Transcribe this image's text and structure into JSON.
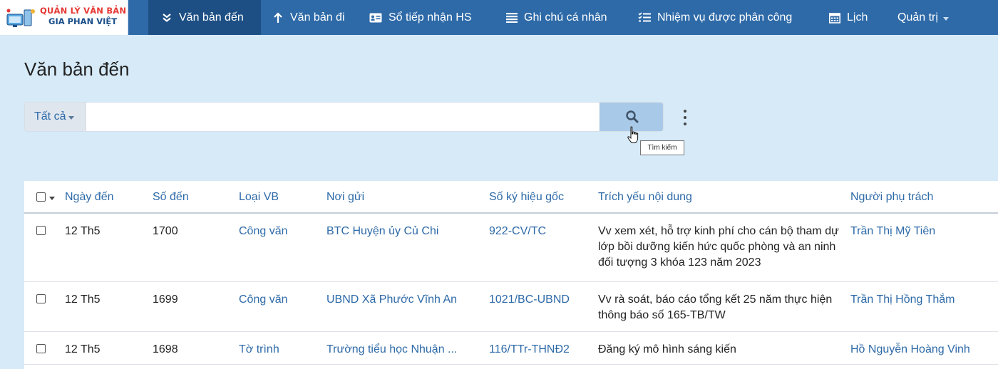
{
  "logo": {
    "line1": "QUẢN LÝ VĂN BẢN",
    "line2": "GIA PHAN VIỆT"
  },
  "nav": {
    "items": [
      {
        "label": "Văn bản đến",
        "icon": "double-chevron-down-icon",
        "active": true
      },
      {
        "label": "Văn bản đi",
        "icon": "arrow-up-icon",
        "active": false
      },
      {
        "label": "Sổ tiếp nhận HS",
        "icon": "id-card-icon",
        "active": false
      },
      {
        "label": "Ghi chú cá nhân",
        "icon": "list-lines-icon",
        "active": false
      },
      {
        "label": "Nhiệm vụ được phân công",
        "icon": "checklist-icon",
        "active": false
      },
      {
        "label": "Lịch",
        "icon": "calendar-icon",
        "active": false
      },
      {
        "label": "Quản trị",
        "icon": "caret-down-icon",
        "active": false
      }
    ]
  },
  "page": {
    "title": "Văn bản đến"
  },
  "search": {
    "scope_label": "Tất cả",
    "value": "",
    "placeholder": "",
    "button_icon": "search-icon",
    "tooltip": "Tìm kiếm"
  },
  "table": {
    "headers": {
      "date": "Ngày đến",
      "number": "Số đến",
      "type": "Loại VB",
      "sender": "Nơi gửi",
      "code": "Số ký hiệu gốc",
      "summary": "Trích yếu nội dung",
      "owner": "Người phụ trách"
    },
    "rows": [
      {
        "date": "12 Th5",
        "number": "1700",
        "type": "Công văn",
        "sender": "BTC Huyện ủy Củ Chi",
        "code": "922-CV/TC",
        "summary": "Vv xem xét, hỗ trợ kinh phí cho cán bộ tham dự lớp bồi dưỡng kiến hức quốc phòng và an ninh đối tượng 3 khóa 123 năm 2023",
        "owner": "Trần Thị Mỹ Tiên"
      },
      {
        "date": "12 Th5",
        "number": "1699",
        "type": "Công văn",
        "sender": "UBND Xã Phước Vĩnh An",
        "code": "1021/BC-UBND",
        "summary": "Vv rà soát, báo cáo tổng kết 25 năm thực hiện thông báo số 165-TB/TW",
        "owner": "Trần Thị Hồng Thắm"
      },
      {
        "date": "12 Th5",
        "number": "1698",
        "type": "Tờ trình",
        "sender": "Trường tiểu học Nhuận ...",
        "code": "116/TTr-THNĐ2",
        "summary": "Đăng ký mô hình sáng kiến",
        "owner": "Hồ Nguyễn Hoàng Vinh"
      }
    ]
  }
}
